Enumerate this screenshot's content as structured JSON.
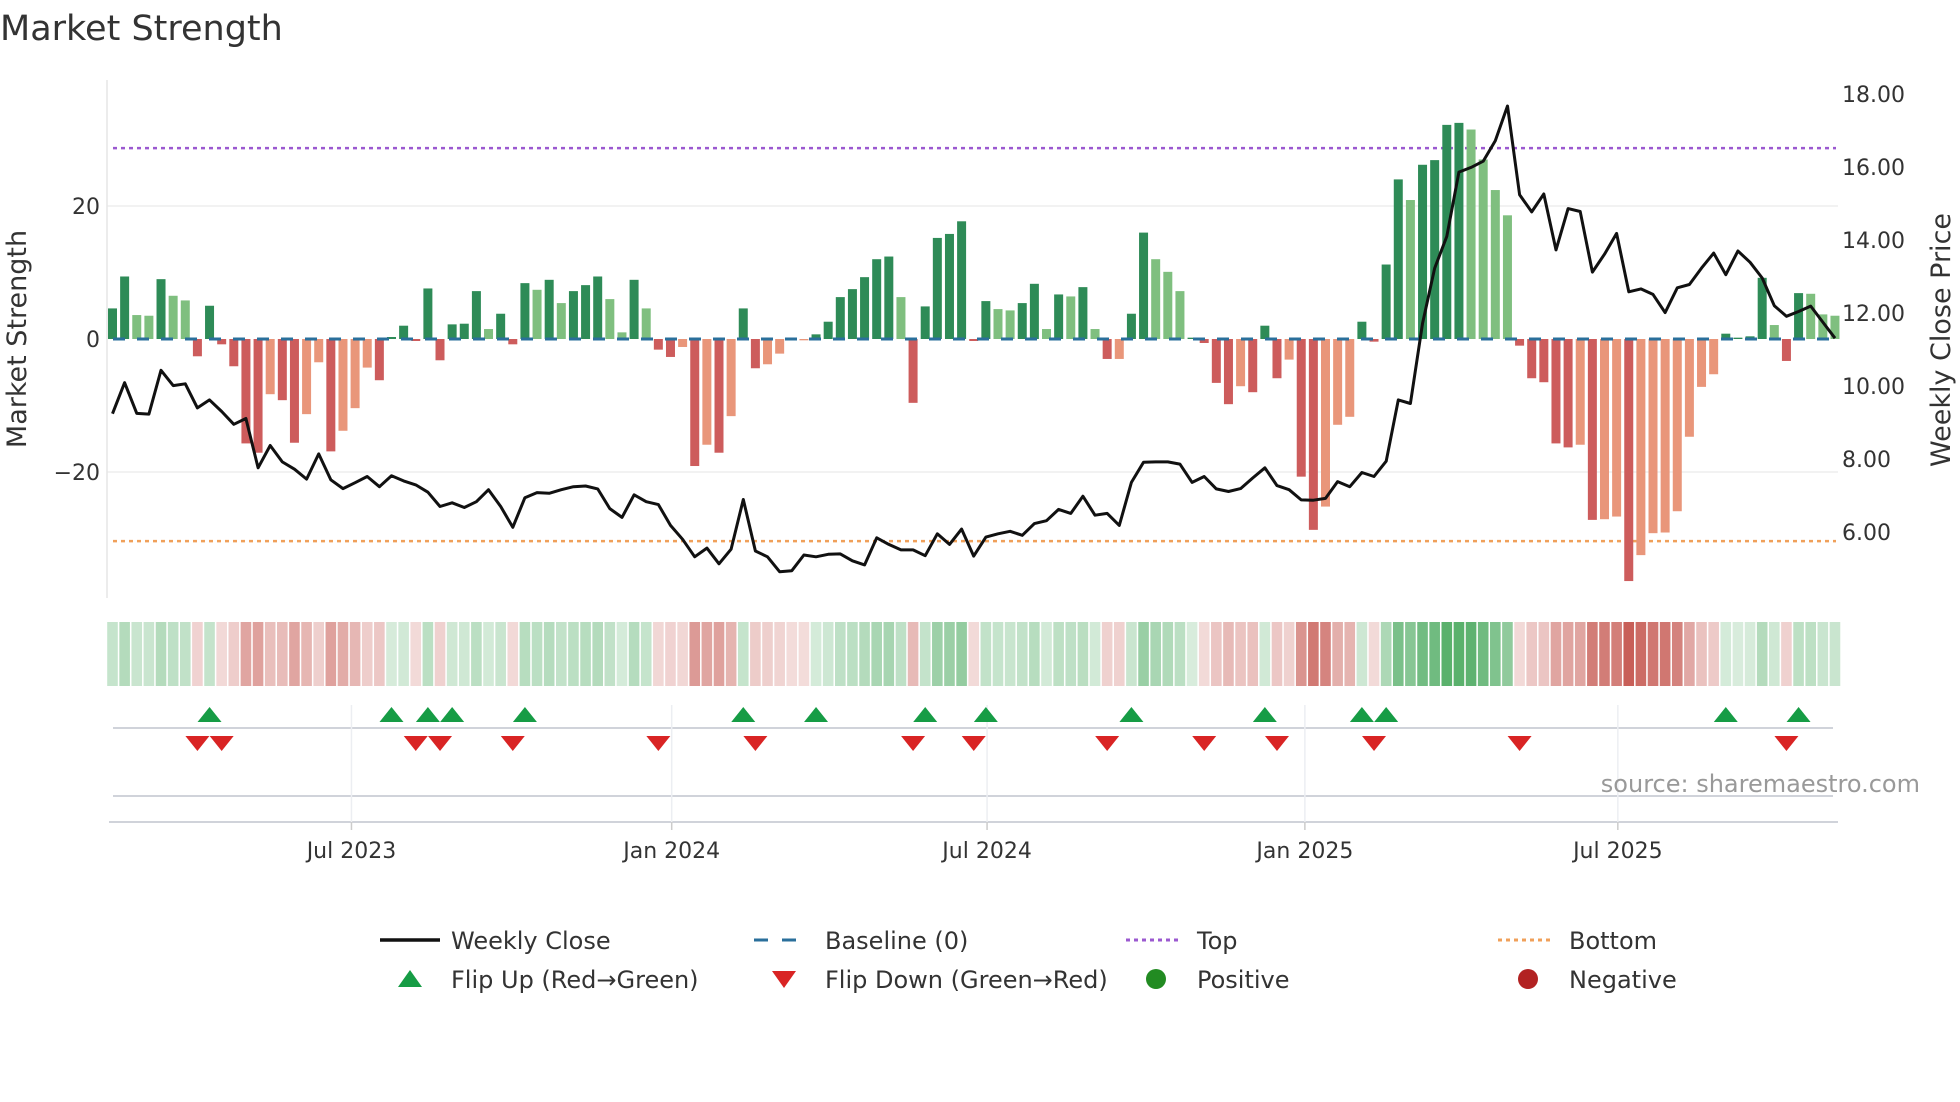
{
  "title": "Market Strength",
  "source": "source: sharemaestro.com",
  "colors": {
    "strong_green": "#2e8b57",
    "weak_green": "#7fbf7f",
    "strong_red": "#cd5c5c",
    "weak_red": "#e9967a",
    "close": "#111111",
    "baseline": "#2a6f9b",
    "top": "#9b59d0",
    "bottom": "#f0a05a",
    "flip_up": "#169c45",
    "flip_down": "#d92424",
    "positive": "#228b22",
    "negative": "#b22222"
  },
  "chart_data": {
    "type": "bar",
    "title": "Market Strength",
    "ylabel": "Market Strength",
    "y2label": "Weekly Close Price",
    "ylim": [
      -39,
      37
    ],
    "y2lim": [
      4.1,
      18.8
    ],
    "yticks": [
      {
        "v": 20,
        "label": "20"
      },
      {
        "v": 0,
        "label": "0"
      },
      {
        "v": -20,
        "label": "−20"
      }
    ],
    "y2ticks": [
      {
        "v": 18,
        "label": "18.00"
      },
      {
        "v": 16,
        "label": "16.00"
      },
      {
        "v": 14,
        "label": "14.00"
      },
      {
        "v": 12,
        "label": "12.00"
      },
      {
        "v": 10,
        "label": "10.00"
      },
      {
        "v": 8,
        "label": "8.00"
      },
      {
        "v": 6,
        "label": "6.00"
      }
    ],
    "xticks": [
      {
        "week": 19.7,
        "label": "Jul 2023"
      },
      {
        "week": 46.1,
        "label": "Jan 2024"
      },
      {
        "week": 72.1,
        "label": "Jul 2024"
      },
      {
        "week": 98.3,
        "label": "Jan 2025"
      },
      {
        "week": 124.1,
        "label": "Jul 2025"
      }
    ],
    "top_level": 28.7,
    "bottom_level": -30.4,
    "baseline": 0,
    "strength": [
      4.6,
      9.4,
      3.6,
      3.5,
      9.0,
      6.5,
      5.8,
      -2.6,
      5.0,
      -0.8,
      -4.1,
      -15.7,
      -17.1,
      -8.3,
      -9.2,
      -15.6,
      -11.3,
      -3.5,
      -16.9,
      -13.8,
      -10.4,
      -4.3,
      -6.2,
      0.3,
      2.0,
      -0.3,
      7.6,
      -3.2,
      2.2,
      2.3,
      7.2,
      1.5,
      3.8,
      -0.8,
      8.4,
      7.4,
      8.9,
      5.4,
      7.2,
      8.1,
      9.4,
      6.0,
      1.0,
      8.9,
      4.6,
      -1.6,
      -2.7,
      -1.2,
      -19.1,
      -15.9,
      -17.1,
      -11.6,
      4.6,
      -4.4,
      -3.8,
      -2.2,
      -0.2,
      -0.2,
      0.7,
      2.6,
      6.3,
      7.5,
      9.3,
      12.0,
      12.4,
      6.3,
      -9.6,
      4.9,
      15.2,
      15.8,
      17.7,
      -0.3,
      5.7,
      4.5,
      4.3,
      5.4,
      8.3,
      1.5,
      6.7,
      6.4,
      7.8,
      1.5,
      -3.0,
      -3.0,
      3.8,
      16.0,
      12.0,
      10.1,
      7.2,
      0.2,
      -0.6,
      -6.6,
      -9.8,
      -7.1,
      -8.0,
      2.0,
      -5.9,
      -3.1,
      -20.7,
      -28.7,
      -25.2,
      -12.9,
      -11.7,
      2.6,
      -0.4,
      11.2,
      24.0,
      20.9,
      26.2,
      26.9,
      32.2,
      32.5,
      31.5,
      27.0,
      22.4,
      18.6,
      -1.0,
      -5.9,
      -6.5,
      -15.7,
      -16.3,
      -15.9,
      -27.2,
      -27.1,
      -26.7,
      -36.4,
      -32.5,
      -29.2,
      -29.1,
      -25.9,
      -14.7,
      -7.2,
      -5.3,
      0.8,
      0.2,
      0.4,
      9.2,
      2.1,
      -3.3,
      6.9,
      6.8,
      3.7,
      3.5
    ],
    "strength_shade": "GGggGggRGRRRRrRRrrRrrrRGGRGRGGGgGRGgGgGGGggGgRRrRrRrGRrrrrGGGGGGGgRGGGGRGggGGgGgGgRrGGgggGRRRrRGRrRRrrrGRGGgGGGGggggRRRRRrRrrRrrrrrrrGGGGgRGggg",
    "weekly_close": [
      9.24,
      10.09,
      9.25,
      9.23,
      10.43,
      10.01,
      10.06,
      9.4,
      9.62,
      9.3,
      8.95,
      9.11,
      7.76,
      8.37,
      7.92,
      7.72,
      7.45,
      8.14,
      7.43,
      7.19,
      7.35,
      7.52,
      7.24,
      7.54,
      7.4,
      7.29,
      7.09,
      6.7,
      6.8,
      6.67,
      6.83,
      7.16,
      6.7,
      6.13,
      6.94,
      7.08,
      7.06,
      7.16,
      7.24,
      7.26,
      7.18,
      6.64,
      6.4,
      7.02,
      6.83,
      6.75,
      6.18,
      5.8,
      5.32,
      5.56,
      5.13,
      5.53,
      6.89,
      5.48,
      5.32,
      4.91,
      4.94,
      5.37,
      5.32,
      5.39,
      5.4,
      5.21,
      5.1,
      5.84,
      5.66,
      5.51,
      5.51,
      5.35,
      5.95,
      5.66,
      6.08,
      5.34,
      5.86,
      5.95,
      6.02,
      5.91,
      6.23,
      6.31,
      6.62,
      6.51,
      6.98,
      6.46,
      6.51,
      6.18,
      7.36,
      7.91,
      7.92,
      7.92,
      7.86,
      7.36,
      7.52,
      7.18,
      7.11,
      7.19,
      7.48,
      7.76,
      7.27,
      7.16,
      6.88,
      6.87,
      6.92,
      7.38,
      7.24,
      7.63,
      7.52,
      7.94,
      9.62,
      9.52,
      11.71,
      13.23,
      14.1,
      15.86,
      15.99,
      16.16,
      16.72,
      17.67,
      15.24,
      14.77,
      15.26,
      13.73,
      14.86,
      14.78,
      13.12,
      13.61,
      14.18,
      12.58,
      12.66,
      12.51,
      12.01,
      12.69,
      12.78,
      13.23,
      13.64,
      13.05,
      13.7,
      13.39,
      12.96,
      12.2,
      11.91,
      12.04,
      12.19,
      11.75,
      11.31
    ],
    "flip_up_weeks": [
      8,
      23,
      26,
      28,
      34,
      52,
      58,
      67,
      72,
      84,
      95,
      103,
      105,
      133,
      139
    ],
    "flip_down_weeks": [
      7,
      9,
      25,
      27,
      33,
      45,
      53,
      66,
      71,
      82,
      90,
      96,
      104,
      116,
      138
    ]
  },
  "legend": [
    {
      "label": "Weekly Close",
      "symbol": "solid-line"
    },
    {
      "label": "Baseline (0)",
      "symbol": "dashed-line"
    },
    {
      "label": "Top",
      "symbol": "dotted-purple"
    },
    {
      "label": "Bottom",
      "symbol": "dotted-orange"
    },
    {
      "label": "Flip Up (Red→Green)",
      "symbol": "triangle-up"
    },
    {
      "label": "Flip Down (Green→Red)",
      "symbol": "triangle-down"
    },
    {
      "label": "Positive",
      "symbol": "green-dot"
    },
    {
      "label": "Negative",
      "symbol": "red-dot"
    }
  ]
}
